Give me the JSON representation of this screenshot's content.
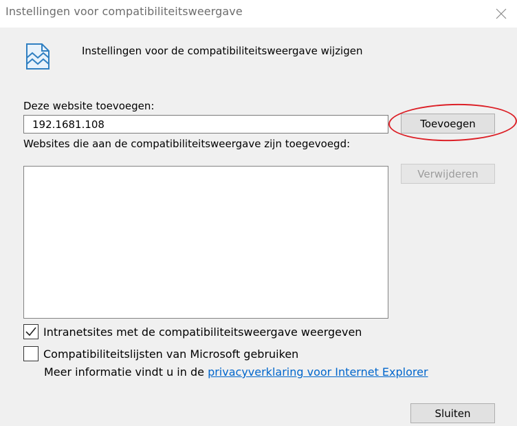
{
  "window": {
    "title": "Instellingen voor compatibiliteitsweergave",
    "close_icon": "close-x-icon"
  },
  "header": {
    "icon": "broken-page-icon",
    "text": "Instellingen voor de compatibiliteitsweergave wijzigen"
  },
  "add_site": {
    "label": "Deze website toevoegen:",
    "value": "192.1681.108",
    "button_label": "Toevoegen"
  },
  "site_list": {
    "label": "Websites die aan de compatibiliteitsweergave zijn toegevoegd:",
    "items": [],
    "remove_button_label": "Verwijderen"
  },
  "options": {
    "intranet": {
      "label": "Intranetsites met de compatibiliteitsweergave weergeven",
      "checked": true
    },
    "microsoft_lists": {
      "label": "Compatibiliteitslijsten van Microsoft gebruiken",
      "checked": false
    }
  },
  "more_info": {
    "text": "Meer informatie vindt u in de ",
    "link_text": "privacyverklaring voor Internet Explorer"
  },
  "footer": {
    "close_label": "Sluiten"
  },
  "colors": {
    "highlight_oval": "#dc1f26",
    "link": "#0066cc"
  }
}
